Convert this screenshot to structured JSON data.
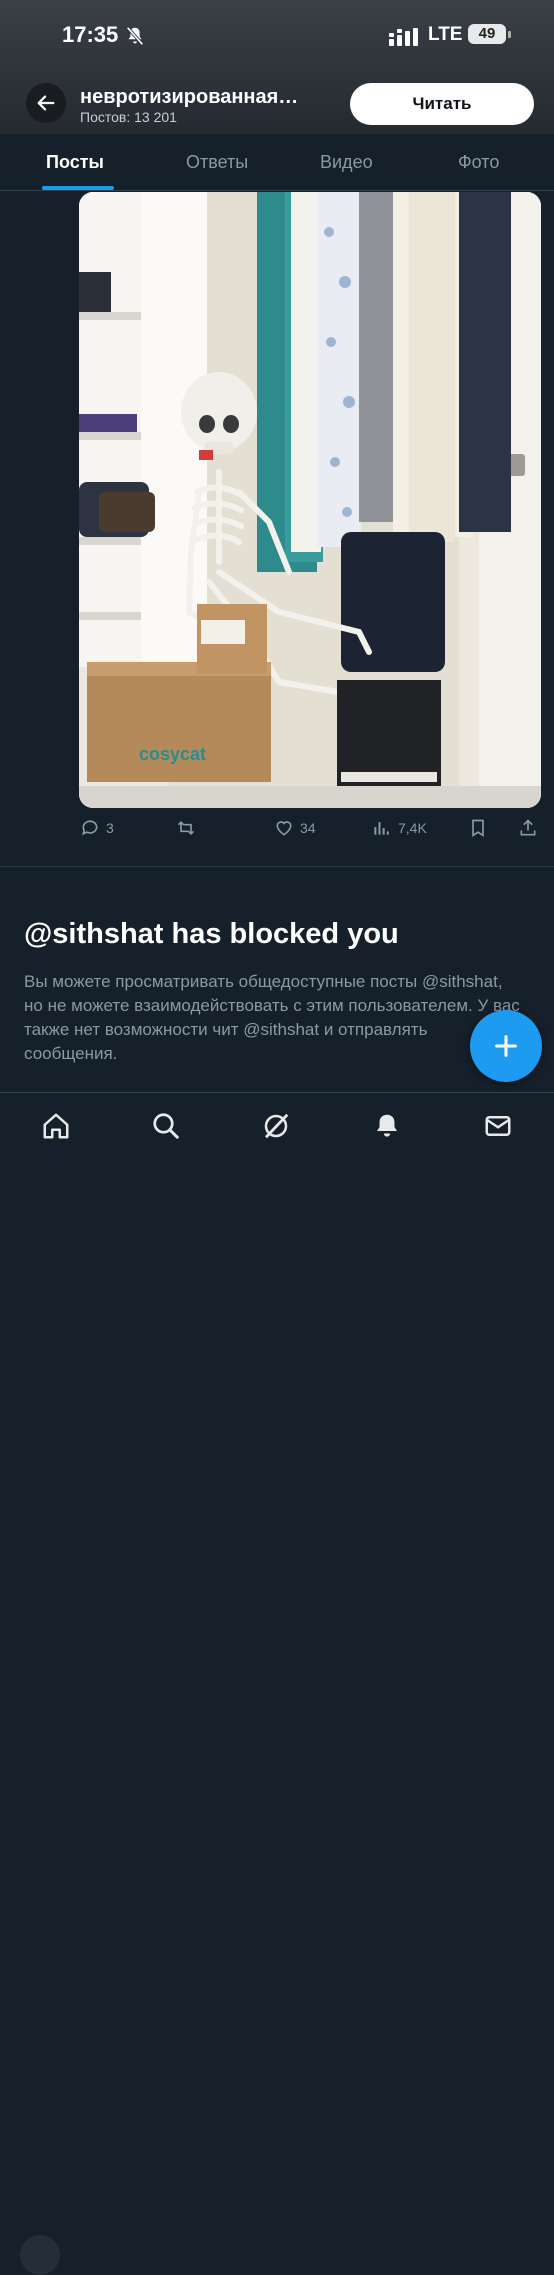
{
  "status_bar": {
    "time": "17:35",
    "network": "LTE",
    "battery": "49"
  },
  "header": {
    "title": "невротизированная…",
    "subtitle": "Постов: 13 201",
    "read_button": "Читать"
  },
  "tabs": [
    {
      "label": "Посты",
      "active": true
    },
    {
      "label": "Ответы",
      "active": false
    },
    {
      "label": "Видео",
      "active": false
    },
    {
      "label": "Фото",
      "active": false
    }
  ],
  "post": {
    "image_text": "cosycat",
    "actions": {
      "replies": "3",
      "retweets": "",
      "likes": "34",
      "views": "7,4K"
    }
  },
  "blocked": {
    "title": "@sithshat has blocked you",
    "text": "Вы можете просматривать общедоступные посты @sithshat, но не можете взаимодействовать с этим пользователем. У вас также нет возможности чит @sithshat и отправлять сообщения."
  },
  "colors": {
    "accent": "#1d9bf0",
    "background": "#15202b",
    "muted": "#8b98a5"
  },
  "bottom_nav": [
    "home-icon",
    "search-icon",
    "grok-icon",
    "notifications-icon",
    "messages-icon"
  ]
}
